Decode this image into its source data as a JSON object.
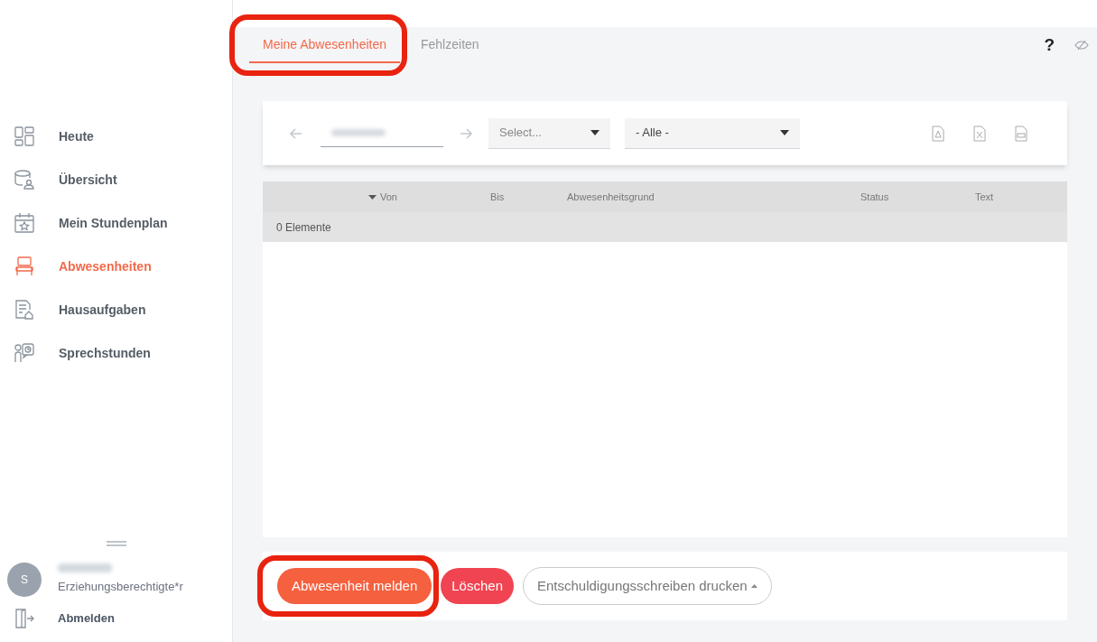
{
  "sidebar": {
    "items": [
      {
        "label": "Heute",
        "selected": false
      },
      {
        "label": "Übersicht",
        "selected": false
      },
      {
        "label": "Mein Stundenplan",
        "selected": false
      },
      {
        "label": "Abwesenheiten",
        "selected": true
      },
      {
        "label": "Hausaufgaben",
        "selected": false
      },
      {
        "label": "Sprechstunden",
        "selected": false
      }
    ],
    "user": {
      "initial": "S",
      "role": "Erziehungsberechtigte*r"
    },
    "logout": "Abmelden"
  },
  "tabs": [
    {
      "label": "Meine Abwesenheiten",
      "selected": true,
      "highlighted": true
    },
    {
      "label": "Fehlzeiten",
      "selected": false,
      "highlighted": false
    }
  ],
  "help": "?",
  "toolbar": {
    "class_select": {
      "placeholder": "Select..."
    },
    "status_select": {
      "value": "- Alle -"
    }
  },
  "table": {
    "columns": [
      {
        "label": "Von",
        "sorted": true
      },
      {
        "label": "Bis",
        "sorted": false
      },
      {
        "label": "Abwesenheitsgrund",
        "sorted": false
      },
      {
        "label": "Status",
        "sorted": false
      },
      {
        "label": "Text",
        "sorted": false
      }
    ],
    "count": "0 Elemente"
  },
  "buttons": [
    {
      "label": "Abwesenheit melden",
      "kind": "primary",
      "highlighted": true
    },
    {
      "label": "Löschen",
      "kind": "danger",
      "highlighted": false
    },
    {
      "label": "Entschuldigungsschreiben drucken",
      "kind": "outline",
      "highlighted": false
    }
  ]
}
